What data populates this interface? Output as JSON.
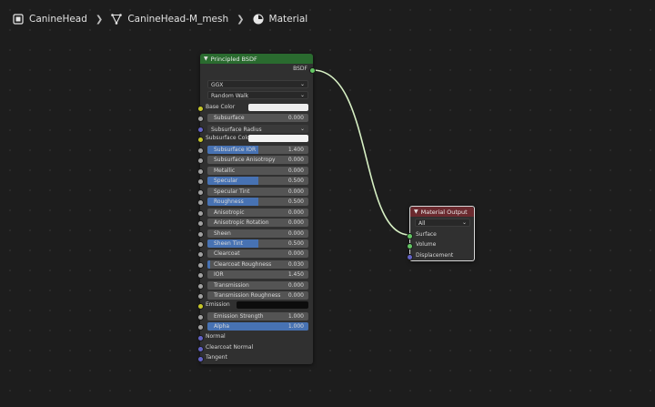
{
  "breadcrumb": {
    "object": "CanineHead",
    "mesh": "CanineHead-M_mesh",
    "material": "Material",
    "icons": [
      "object-icon",
      "mesh-icon",
      "material-icon"
    ]
  },
  "bsdf_node": {
    "title": "Principled BSDF",
    "header_color": "#2a6b2f",
    "output_label": "BSDF",
    "distribution": "GGX",
    "subsurface_method": "Random Walk",
    "base_color_label": "Base Color",
    "base_color": "#eeeeee",
    "subsurface_radius_label": "Subsurface Radius",
    "subsurface_color_label": "Subsurface Color",
    "subsurface_color": "#f3f3f3",
    "emission_label": "Emission",
    "emission_color": "#0c0c0c",
    "fields": [
      {
        "label": "Subsurface",
        "value": "0.000",
        "fill": 0
      },
      {
        "label": "Subsurface IOR",
        "value": "1.400",
        "fill": 0.5
      },
      {
        "label": "Subsurface Anisotropy",
        "value": "0.000",
        "fill": 0
      },
      {
        "label": "Metallic",
        "value": "0.000",
        "fill": 0
      },
      {
        "label": "Specular",
        "value": "0.500",
        "fill": 0.5
      },
      {
        "label": "Specular Tint",
        "value": "0.000",
        "fill": 0
      },
      {
        "label": "Roughness",
        "value": "0.500",
        "fill": 0.5
      },
      {
        "label": "Anisotropic",
        "value": "0.000",
        "fill": 0
      },
      {
        "label": "Anisotropic Rotation",
        "value": "0.000",
        "fill": 0
      },
      {
        "label": "Sheen",
        "value": "0.000",
        "fill": 0
      },
      {
        "label": "Sheen Tint",
        "value": "0.500",
        "fill": 0.5
      },
      {
        "label": "Clearcoat",
        "value": "0.000",
        "fill": 0
      },
      {
        "label": "Clearcoat Roughness",
        "value": "0.030",
        "fill": 0.03
      },
      {
        "label": "IOR",
        "value": "1.450",
        "fill": 0
      },
      {
        "label": "Transmission",
        "value": "0.000",
        "fill": 0
      },
      {
        "label": "Transmission Roughness",
        "value": "0.000",
        "fill": 0
      },
      {
        "label": "Emission Strength",
        "value": "1.000",
        "fill": 0
      },
      {
        "label": "Alpha",
        "value": "1.000",
        "fill": 1
      }
    ],
    "vector_inputs": [
      "Normal",
      "Clearcoat Normal",
      "Tangent"
    ]
  },
  "output_node": {
    "title": "Material Output",
    "header_color": "#6b2a2f",
    "target": "All",
    "inputs": [
      "Surface",
      "Volume",
      "Displacement"
    ]
  },
  "colors": {
    "wire": "#d7f0c4",
    "field_fill": "#4772b3",
    "socket_shader": "#63c763",
    "socket_color": "#c7c729",
    "socket_float": "#a1a1a1",
    "socket_vector": "#6363c7"
  }
}
